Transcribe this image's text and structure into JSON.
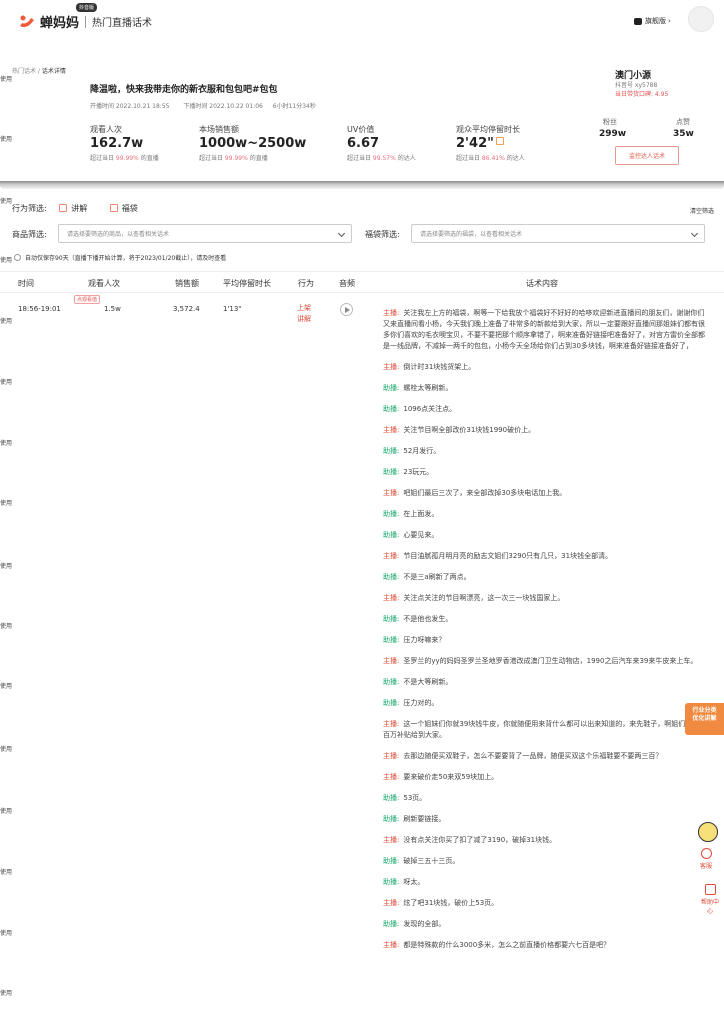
{
  "header": {
    "logo_text": "蝉妈妈",
    "logo_badge": "抖音版",
    "subtitle": "热门直播话术",
    "vip_label": "旗舰版"
  },
  "side_labels": [
    "使用",
    "使用",
    "使用",
    "使用",
    "使用",
    "使用",
    "使用",
    "使用",
    "使用",
    "使用",
    "使用",
    "使用",
    "使用",
    "使用",
    "使用",
    "使用"
  ],
  "breadcrumb": {
    "parent": "热门话术",
    "sep": " / ",
    "current": "话术详情"
  },
  "live": {
    "title": "降温啦，快来我带走你的新衣服和包包吧#包包",
    "start": "开播时间  2022.10.21 18:55",
    "end": "下播时间  2022.10.22 01:06",
    "duration": "6小时11分34秒"
  },
  "metrics": [
    {
      "label": "观看人次",
      "value": "162.7w",
      "sub_prefix": "超过当日 ",
      "sub_pct": "99.99%",
      "sub_suffix": " 的直播"
    },
    {
      "label": "本场销售额",
      "value": "1000w~2500w",
      "sub_prefix": "超过当日 ",
      "sub_pct": "99.99%",
      "sub_suffix": " 的直播"
    },
    {
      "label": "UV价值",
      "value": "6.67",
      "sub_prefix": "超过当日 ",
      "sub_pct": "99.57%",
      "sub_suffix": " 的达人"
    },
    {
      "label": "观众平均停留时长",
      "value": "2'42\"",
      "sub_prefix": "超过当日 ",
      "sub_pct": "86.41%",
      "sub_suffix": " 的达人"
    }
  ],
  "anchor": {
    "name": "澳门小源",
    "douyin_id": "抖音号 xy5788",
    "score": "当日带货口碑: 4.95",
    "fans_label": "粉丝",
    "fans_value": "299w",
    "likes_label": "点赞",
    "likes_value": "35w",
    "monitor_button": "监控达人话术"
  },
  "filters": {
    "behavior_label": "行为筛选:",
    "behavior_options": [
      "讲解",
      "福袋"
    ],
    "clear": "清空筛选",
    "product_label": "商品筛选:",
    "product_placeholder": "请选择要筛选的商品，以查看相关话术",
    "bag_label": "福袋筛选:",
    "bag_placeholder": "请选择要筛选的福袋，以查看相关话术",
    "note": "自动仅保存90天（直播下播开始计算，将于2023/01/20截止），请及时查看"
  },
  "table": {
    "headers": [
      "时间",
      "观看人次",
      "销售额",
      "平均停留时长",
      "行为",
      "音频",
      "话术内容"
    ],
    "row": {
      "time": "18:56-19:01",
      "hot_tag": "点观看值",
      "views": "1.5w",
      "sales": "3,572.4",
      "avg_stay": "1'13\"",
      "behavior_1": "上架",
      "behavior_2": "讲解"
    }
  },
  "script": [
    {
      "role": "主播:",
      "type": "host",
      "text": "关注我左上方的福袋，啊等一下给我放个福袋好不好好的哈哆欢迎新进直播间的朋友们，谢谢你们又来直播间看小杨，今天我们晚上准备了非常多的新款给到大家，所以一定要跟好直播间那姐妹们都有很多你们喜欢的毛衣噢宝贝，不要不要把那个顺序拿错了，啊来准备好链接吧准备好了，对宫方雷价全部都是一线品牌，不减掉一两千的包包，小杨今天全场给你们占到30多块钱，啊来准备好链接准备好了，"
    },
    {
      "role": "主播:",
      "type": "host",
      "text": "倒计时31块钱货架上。"
    },
    {
      "role": "助播:",
      "type": "assist",
      "text": "螺栓太等刷新。"
    },
    {
      "role": "助播:",
      "type": "assist",
      "text": "1096点关注点。"
    },
    {
      "role": "主播:",
      "type": "host",
      "text": "关注节目啊全部改价31块钱1990破价上。"
    },
    {
      "role": "助播:",
      "type": "assist",
      "text": "52月发行。"
    },
    {
      "role": "助播:",
      "type": "assist",
      "text": "23玩元。"
    },
    {
      "role": "主播:",
      "type": "host",
      "text": "吧姐们最后三次了，来全部改掉30多块电话加上我。"
    },
    {
      "role": "助播:",
      "type": "assist",
      "text": "在上面发。"
    },
    {
      "role": "助播:",
      "type": "assist",
      "text": "心要见来。"
    },
    {
      "role": "主播:",
      "type": "host",
      "text": "节目油腻孤月明月亮的励志文姐们3290只有几只，31块钱全部清。"
    },
    {
      "role": "助播:",
      "type": "assist",
      "text": "不是三a刷新了两点。"
    },
    {
      "role": "主播:",
      "type": "host",
      "text": "关注点关注的节目啊漂亮，这一次三一块钱国家上。"
    },
    {
      "role": "助播:",
      "type": "assist",
      "text": "不是他也发生。"
    },
    {
      "role": "助播:",
      "type": "assist",
      "text": "压力呀嘛来？"
    },
    {
      "role": "主播:",
      "type": "host",
      "text": "圣罗兰的yy的妈妈圣罗兰圣地罗香港改成澳门卫生动物店，1990之后汽车来39来牛皮来上车。"
    },
    {
      "role": "助播:",
      "type": "assist",
      "text": "不是大等刷新。"
    },
    {
      "role": "助播:",
      "type": "assist",
      "text": "压力对的。"
    },
    {
      "role": "主播:",
      "type": "host",
      "text": "这一个姐妹们你就39块钱牛皮，你就随便用来背什么都可以出来知道的，来先鞋子，啊姐们全部百万补贴给到大家。"
    },
    {
      "role": "主播:",
      "type": "host",
      "text": "去那边随便买双鞋子，怎么不要要背了一品牌，随便买双这个乐福鞋要不要两三百？"
    },
    {
      "role": "主播:",
      "type": "host",
      "text": "要来破价走50来双59块加上。"
    },
    {
      "role": "助播:",
      "type": "assist",
      "text": "53页。"
    },
    {
      "role": "助播:",
      "type": "assist",
      "text": "刷新要链接。"
    },
    {
      "role": "主播:",
      "type": "host",
      "text": "没有点关注你买了扣了减了3190，破掉31块钱。"
    },
    {
      "role": "助播:",
      "type": "assist",
      "text": "破掉三五十三页。"
    },
    {
      "role": "助播:",
      "type": "assist",
      "text": "呀太。"
    },
    {
      "role": "主播:",
      "type": "host",
      "text": "炫了吧31块钱，破价上53页。"
    },
    {
      "role": "助播:",
      "type": "assist",
      "text": "发现的全部。"
    },
    {
      "role": "主播:",
      "type": "host",
      "text": "都是特殊款的什么3000多米，怎么之前直播价格都要六七百是吧？"
    }
  ],
  "floaters": {
    "orange_line1": "行业分类",
    "orange_line2": "优化讲解",
    "service": "客服",
    "help": "帮助中心"
  },
  "colors": {
    "accent": "#e04a3a",
    "assist": "#18a86a",
    "brand_orange": "#f08a40"
  }
}
